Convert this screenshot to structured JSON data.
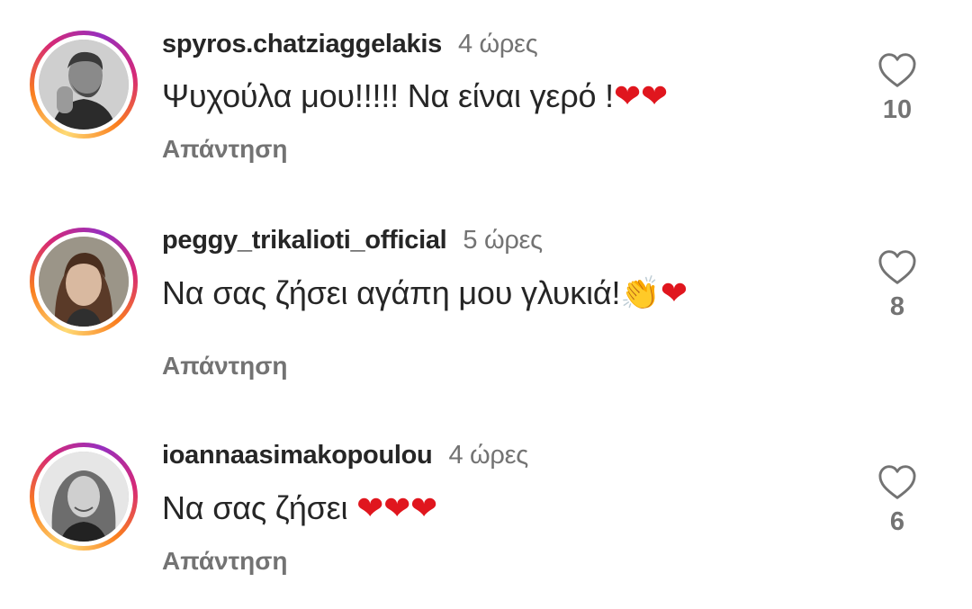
{
  "comments": [
    {
      "username": "spyros.chatziaggelakis",
      "time": "4 ώρες",
      "text": "Ψυχούλα μου!!!!! Να είναι γερό !",
      "emojis": [
        "❤",
        "❤"
      ],
      "reply_label": "Απάντηση",
      "likes": "10"
    },
    {
      "username": "peggy_trikalioti_official",
      "time": "5 ώρες",
      "text": "Να σας ζήσει αγάπη μου γλυκιά!",
      "emojis": [
        "👏",
        "❤"
      ],
      "reply_label": "Απάντηση",
      "likes": "8"
    },
    {
      "username": "ioannaasimakopoulou",
      "time": "4 ώρες",
      "text": "Να σας ζήσει ",
      "emojis": [
        "❤",
        "❤",
        "❤"
      ],
      "reply_label": "Απάντηση",
      "likes": "6"
    }
  ],
  "icons": {
    "like": "heart-outline-icon",
    "heart_emoji": "red-heart-emoji-icon",
    "clap_emoji": "clapping-hands-emoji-icon"
  },
  "colors": {
    "username": "#262626",
    "secondary": "#737373",
    "heart": "#e0161e",
    "ring_start": "#feda75",
    "ring_end": "#962fbf"
  }
}
